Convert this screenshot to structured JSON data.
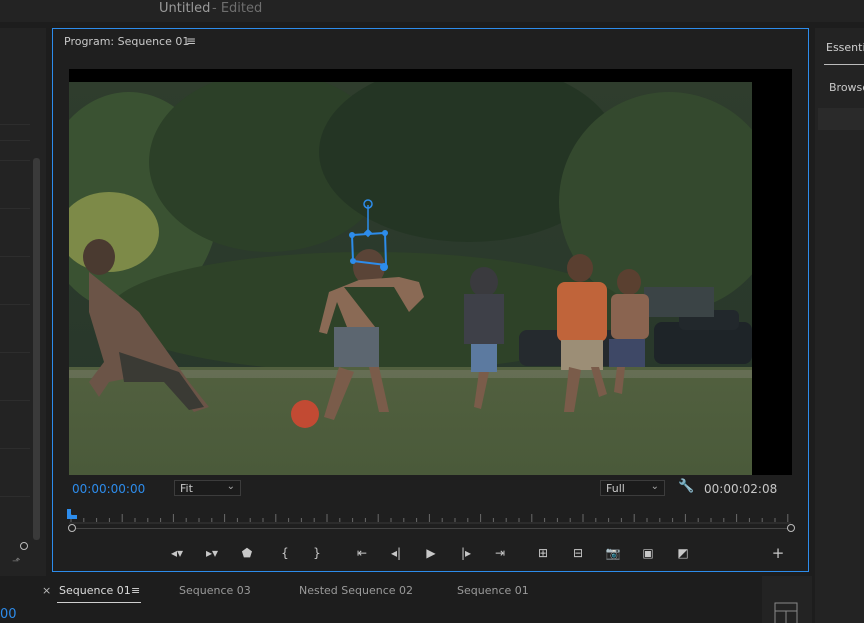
{
  "app": {
    "title": "Untitled",
    "status": "- Edited"
  },
  "monitor": {
    "title": "Program: Sequence 01",
    "menu_icon": "≡",
    "current_timecode": "00:00:00:00",
    "duration_timecode": "00:00:02:08",
    "zoom_level": "Fit",
    "resolution": "Full"
  },
  "right_panel": {
    "tab_essential": "Essentia",
    "tab_browse": "Browse"
  },
  "bottom_tabs": {
    "close_symbol": "×",
    "active_tab": "Sequence 01",
    "active_menu_icon": "≡",
    "tabs": [
      "Sequence 03",
      "Nested Sequence 02",
      "Sequence 01"
    ]
  },
  "left_panel": {
    "timecode_fragment": "00"
  },
  "colors": {
    "accent": "#2d8ceb",
    "panel_bg": "#1f1f1f"
  },
  "icons": {
    "transport": [
      "mark-in-icon",
      "mark-out-icon",
      "add-marker-icon",
      "go-to-in-icon",
      "go-to-out-icon",
      "go-to-in-point-icon",
      "step-back-icon",
      "play-icon",
      "step-forward-icon",
      "go-to-out-point-icon",
      "lift-icon",
      "extract-icon",
      "export-frame-icon",
      "comparison-view-icon",
      "proxy-toggle-icon",
      "add-button-icon"
    ]
  }
}
